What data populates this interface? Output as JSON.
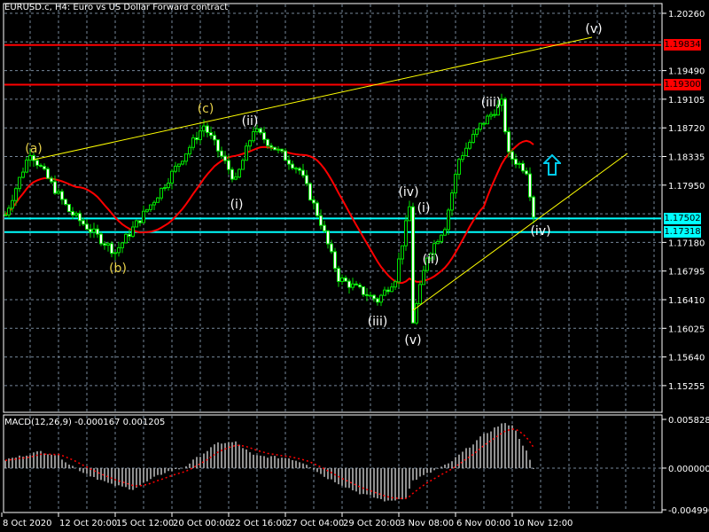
{
  "window": {
    "title": "EURUSD.c, H4:  Euro vs US Dollar Forward contract"
  },
  "colors": {
    "background": "#000000",
    "grid": "#76879a",
    "candle": "#00e000",
    "ma": "#ff0000",
    "trendline": "#ffff00",
    "resistance": "#ff0000",
    "support": "#00ffff",
    "wave_yellow": "#e8d24a",
    "wave_white": "#ffffff",
    "macd_hist": "#c0c0c0",
    "macd_signal": "#ff0000",
    "arrow": "#00ccee"
  },
  "price_axis": {
    "ticks": [
      "1.20260",
      "1.19490",
      "1.19105",
      "1.18720",
      "1.18335",
      "1.17950",
      "1.17180",
      "1.16795",
      "1.16410",
      "1.16025",
      "1.15640",
      "1.15255"
    ],
    "range": [
      1.15,
      1.2044
    ]
  },
  "price_levels": [
    {
      "label": "1.19834",
      "value": 1.19834,
      "kind": "resistance"
    },
    {
      "label": "1.19300",
      "value": 1.193,
      "kind": "resistance"
    },
    {
      "label": "1.17502",
      "value": 1.17502,
      "kind": "support"
    },
    {
      "label": "1.17318",
      "value": 1.17318,
      "kind": "support"
    }
  ],
  "time_axis": {
    "labels": [
      "8 Oct 2020",
      "12 Oct 20:00",
      "15 Oct 12:00",
      "20 Oct 00:00",
      "22 Oct 16:00",
      "27 Oct 04:00",
      "29 Oct 20:00",
      "3 Nov 08:00",
      "6 Nov 00:00",
      "10 Nov 12:00"
    ]
  },
  "waves": {
    "a": "(a)",
    "b": "(b)",
    "c": "(c)",
    "v_top": "(v)",
    "ii_1": "(ii)",
    "i_1": "(i)",
    "iv_1": "(iv)",
    "iii_1": "(iii)",
    "v_1": "(v)",
    "i_2": "(i)",
    "ii_2": "(ii)",
    "iii_2": "(iii)",
    "iv_2": "(iv)"
  },
  "macd": {
    "title": "MACD(12,26,9) -0.000167 0.001205",
    "axis_ticks": [
      "0.005828",
      "0.000000",
      "-0.004990"
    ],
    "range": [
      -0.00499,
      0.005828
    ]
  },
  "chart_data": {
    "type": "candlestick",
    "symbol": "EURUSD.c",
    "timeframe": "H4",
    "bar_count": 150,
    "price_keypoints": [
      [
        0,
        1.1755
      ],
      [
        7,
        1.184
      ],
      [
        18,
        1.176
      ],
      [
        31,
        1.1705
      ],
      [
        42,
        1.1775
      ],
      [
        56,
        1.1875
      ],
      [
        65,
        1.18
      ],
      [
        70,
        1.187
      ],
      [
        83,
        1.1815
      ],
      [
        89,
        1.1745
      ],
      [
        94,
        1.167
      ],
      [
        105,
        1.164
      ],
      [
        110,
        1.167
      ],
      [
        114,
        1.1765
      ],
      [
        115,
        1.1612
      ],
      [
        119,
        1.17
      ],
      [
        124,
        1.174
      ],
      [
        128,
        1.183
      ],
      [
        134,
        1.1875
      ],
      [
        140,
        1.1905
      ],
      [
        142,
        1.1835
      ],
      [
        147,
        1.1815
      ],
      [
        149,
        1.1755
      ]
    ],
    "macd_keypoints": [
      [
        0,
        0.001
      ],
      [
        10,
        0.002
      ],
      [
        15,
        0.0015
      ],
      [
        18,
        0.0005
      ],
      [
        22,
        -0.0005
      ],
      [
        30,
        -0.002
      ],
      [
        36,
        -0.0025
      ],
      [
        45,
        -0.0005
      ],
      [
        50,
        0.0
      ],
      [
        55,
        0.0015
      ],
      [
        60,
        0.003
      ],
      [
        65,
        0.0031
      ],
      [
        70,
        0.0015
      ],
      [
        80,
        0.0012
      ],
      [
        85,
        0.0005
      ],
      [
        90,
        -0.001
      ],
      [
        100,
        -0.003
      ],
      [
        108,
        -0.004
      ],
      [
        113,
        -0.0035
      ],
      [
        115,
        -0.0015
      ],
      [
        120,
        -0.0005
      ],
      [
        125,
        0.0005
      ],
      [
        135,
        0.004
      ],
      [
        140,
        0.0053
      ],
      [
        143,
        0.0052
      ],
      [
        147,
        0.002
      ],
      [
        149,
        -0.0002
      ]
    ],
    "trendlines": [
      {
        "from": [
          8,
          1.18293
        ],
        "to": [
          165.5,
          1.19938
        ]
      },
      {
        "from": [
          115,
          1.16267
        ],
        "to": [
          175.5,
          1.18377
        ]
      }
    ]
  }
}
